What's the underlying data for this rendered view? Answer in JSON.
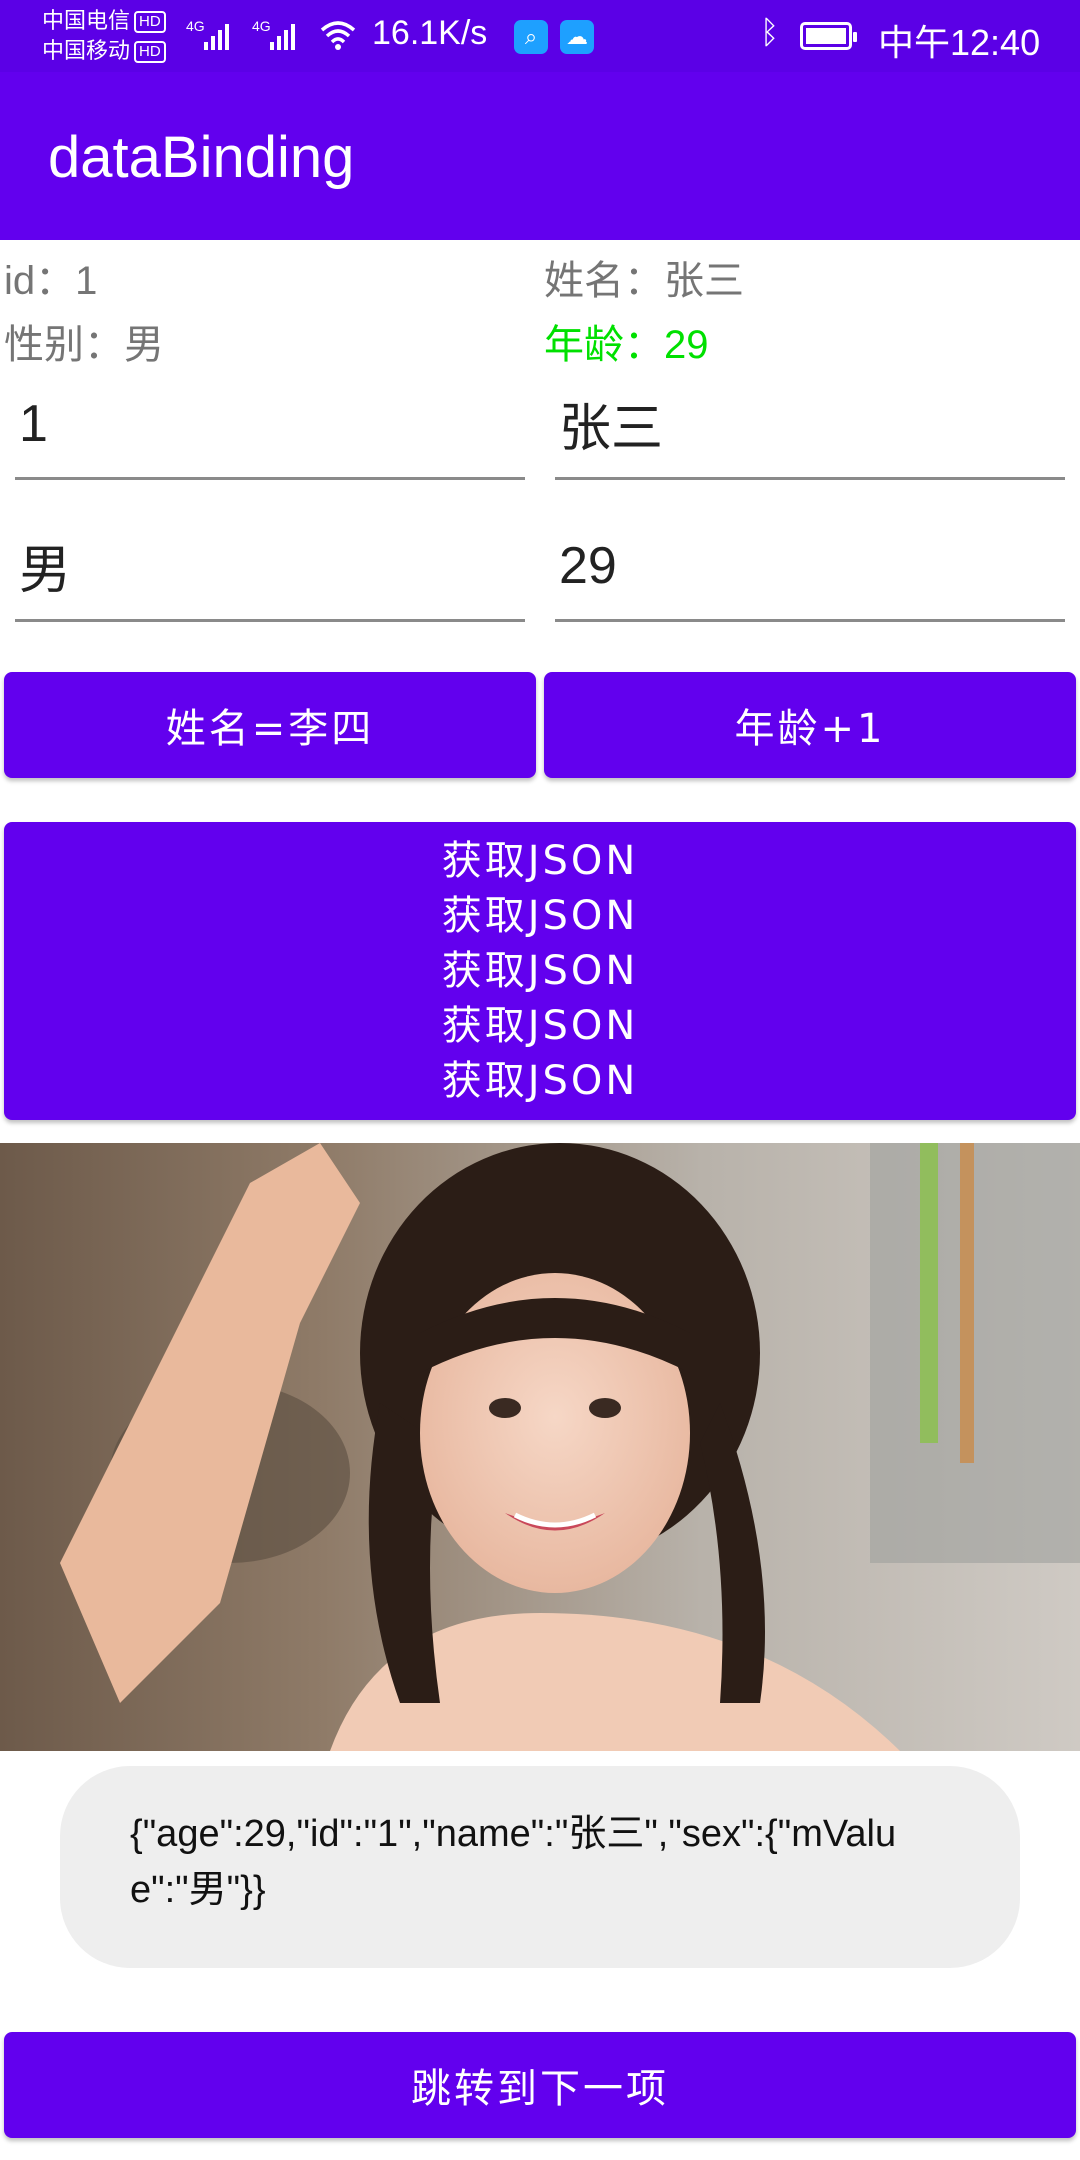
{
  "status_bar": {
    "carrier1": "中国电信",
    "carrier2": "中国移动",
    "hd_badge": "HD",
    "net_tag": "4G",
    "net_speed": "16.1K/s",
    "time": "中午12:40",
    "icons": [
      "signal-icon",
      "wifi-icon",
      "search-app-icon",
      "cloud-app-icon",
      "bluetooth-icon",
      "battery-charging-icon"
    ]
  },
  "app_bar": {
    "title": "dataBinding"
  },
  "info": {
    "id": "id：1",
    "name": "姓名：张三",
    "sex": "性别：男",
    "age": "年龄：29"
  },
  "fields": {
    "id_value": "1",
    "name_value": "张三",
    "sex_value": "男",
    "age_value": "29"
  },
  "buttons": {
    "set_name": "姓名=李四",
    "age_plus": "年龄+1",
    "get_json_lines": [
      "获取JSON",
      "获取JSON",
      "获取JSON",
      "获取JSON",
      "获取JSON"
    ],
    "next": "跳转到下一项"
  },
  "json_output": "{\"age\":29,\"id\":\"1\",\"name\":\"张三\",\"sex\":{\"mValue\":\"男\"}}",
  "colors": {
    "primary": "#6200ee",
    "status_bar": "#5b00e6",
    "age_text": "#00e000",
    "json_bg": "#eeeeee"
  }
}
